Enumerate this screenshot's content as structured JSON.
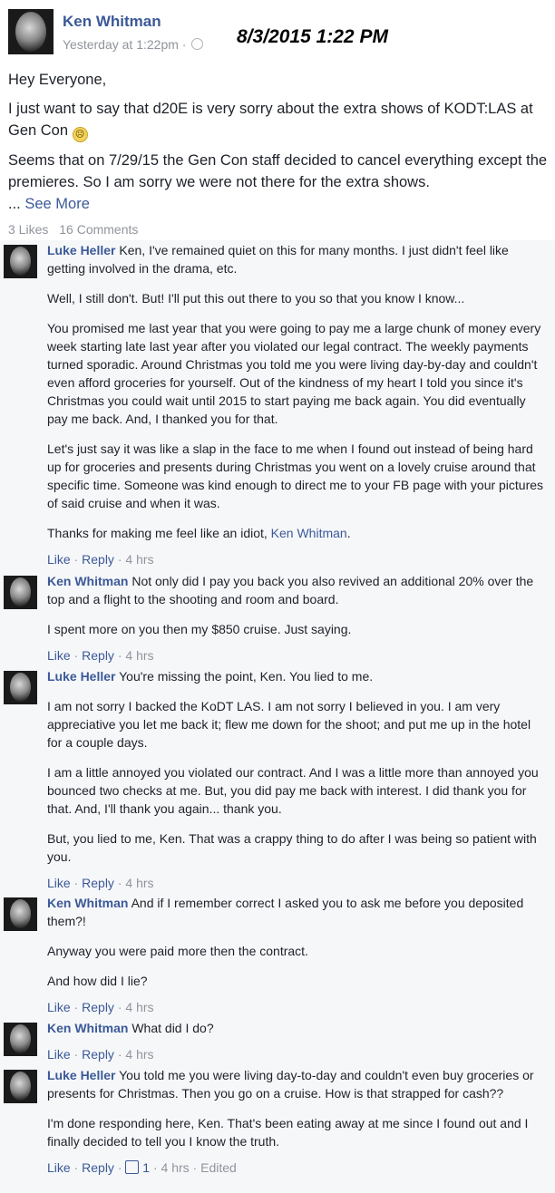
{
  "post": {
    "author": "Ken Whitman",
    "time": "Yesterday at 1:22pm",
    "separator": "·",
    "timestamp_overlay": "8/3/2015 1:22 PM",
    "greeting": "Hey Everyone,",
    "line1": "I just want to say that d20E is very sorry about the extra shows of KODT:LAS at Gen Con",
    "line2": "Seems that on 7/29/15 the Gen Con staff decided to cancel everything except the premieres. So I am sorry we were not there for the extra shows.",
    "ellipsis": "...",
    "see_more": "See More",
    "likes": "3 Likes",
    "comments_count": "16 Comments"
  },
  "comments": [
    {
      "name": "Luke Heller",
      "paragraphs": [
        "Ken, I've remained quiet on this for many months. I just didn't feel like getting involved in the drama, etc.",
        "Well, I still don't. But! I'll put this out there to you so that you know I know...",
        "You promised me last year that you were going to pay me a large chunk of money every week starting late last year after you violated our legal contract. The weekly payments turned sporadic. Around Christmas you told me you were living day-by-day and couldn't even afford groceries for yourself. Out of the kindness of my heart I told you since it's Christmas you could wait until 2015 to start paying me back again. You did eventually pay me back. And, I thanked you for that.",
        "Let's just say it was like a slap in the face to me when I found out instead of being hard up for groceries and presents during Christmas you went on a lovely cruise around that specific time. Someone was kind enough to direct me to your FB page with your pictures of said cruise and when it was.",
        "Thanks for making me feel like an idiot,"
      ],
      "mention": "Ken Whitman",
      "like": "Like",
      "reply": "Reply",
      "time": "4 hrs"
    },
    {
      "name": "Ken Whitman",
      "paragraphs": [
        "Not only did I pay you back you also revived an additional 20% over the top and a flight to the shooting and room and board.",
        "I spent more on you then my $850 cruise. Just saying."
      ],
      "like": "Like",
      "reply": "Reply",
      "time": "4 hrs"
    },
    {
      "name": "Luke Heller",
      "paragraphs": [
        "You're missing the point, Ken. You lied to me.",
        "I am not sorry I backed the KoDT LAS. I am not sorry I believed in you. I am very appreciative you let me back it; flew me down for the shoot; and put me up in the hotel for a couple days.",
        "I am a little annoyed you violated our contract. And I was a little more than annoyed you bounced two checks at me. But, you did pay me back with interest. I did thank you for that. And, I'll thank you again... thank you.",
        "But, you lied to me, Ken. That was a crappy thing to do after I was being so patient with you."
      ],
      "like": "Like",
      "reply": "Reply",
      "time": "4 hrs"
    },
    {
      "name": "Ken Whitman",
      "paragraphs": [
        "And if I remember correct I asked you to ask me before you deposited them?!",
        "Anyway you were paid more then the contract.",
        "And how did I lie?"
      ],
      "like": "Like",
      "reply": "Reply",
      "time": "4 hrs"
    },
    {
      "name": "Ken Whitman",
      "paragraphs": [
        "What did I do?"
      ],
      "like": "Like",
      "reply": "Reply",
      "time": "4 hrs"
    },
    {
      "name": "Luke Heller",
      "paragraphs": [
        "You told me you were living day-to-day and couldn't even buy groceries or presents for Christmas. Then you go on a cruise. How is that strapped for cash??",
        "I'm done responding here, Ken. That's been eating away at me since I found out and I finally decided to tell you I know the truth."
      ],
      "like": "Like",
      "reply": "Reply",
      "reaction_count": "1",
      "time": "4 hrs",
      "edited": "Edited"
    }
  ],
  "sep": "·"
}
